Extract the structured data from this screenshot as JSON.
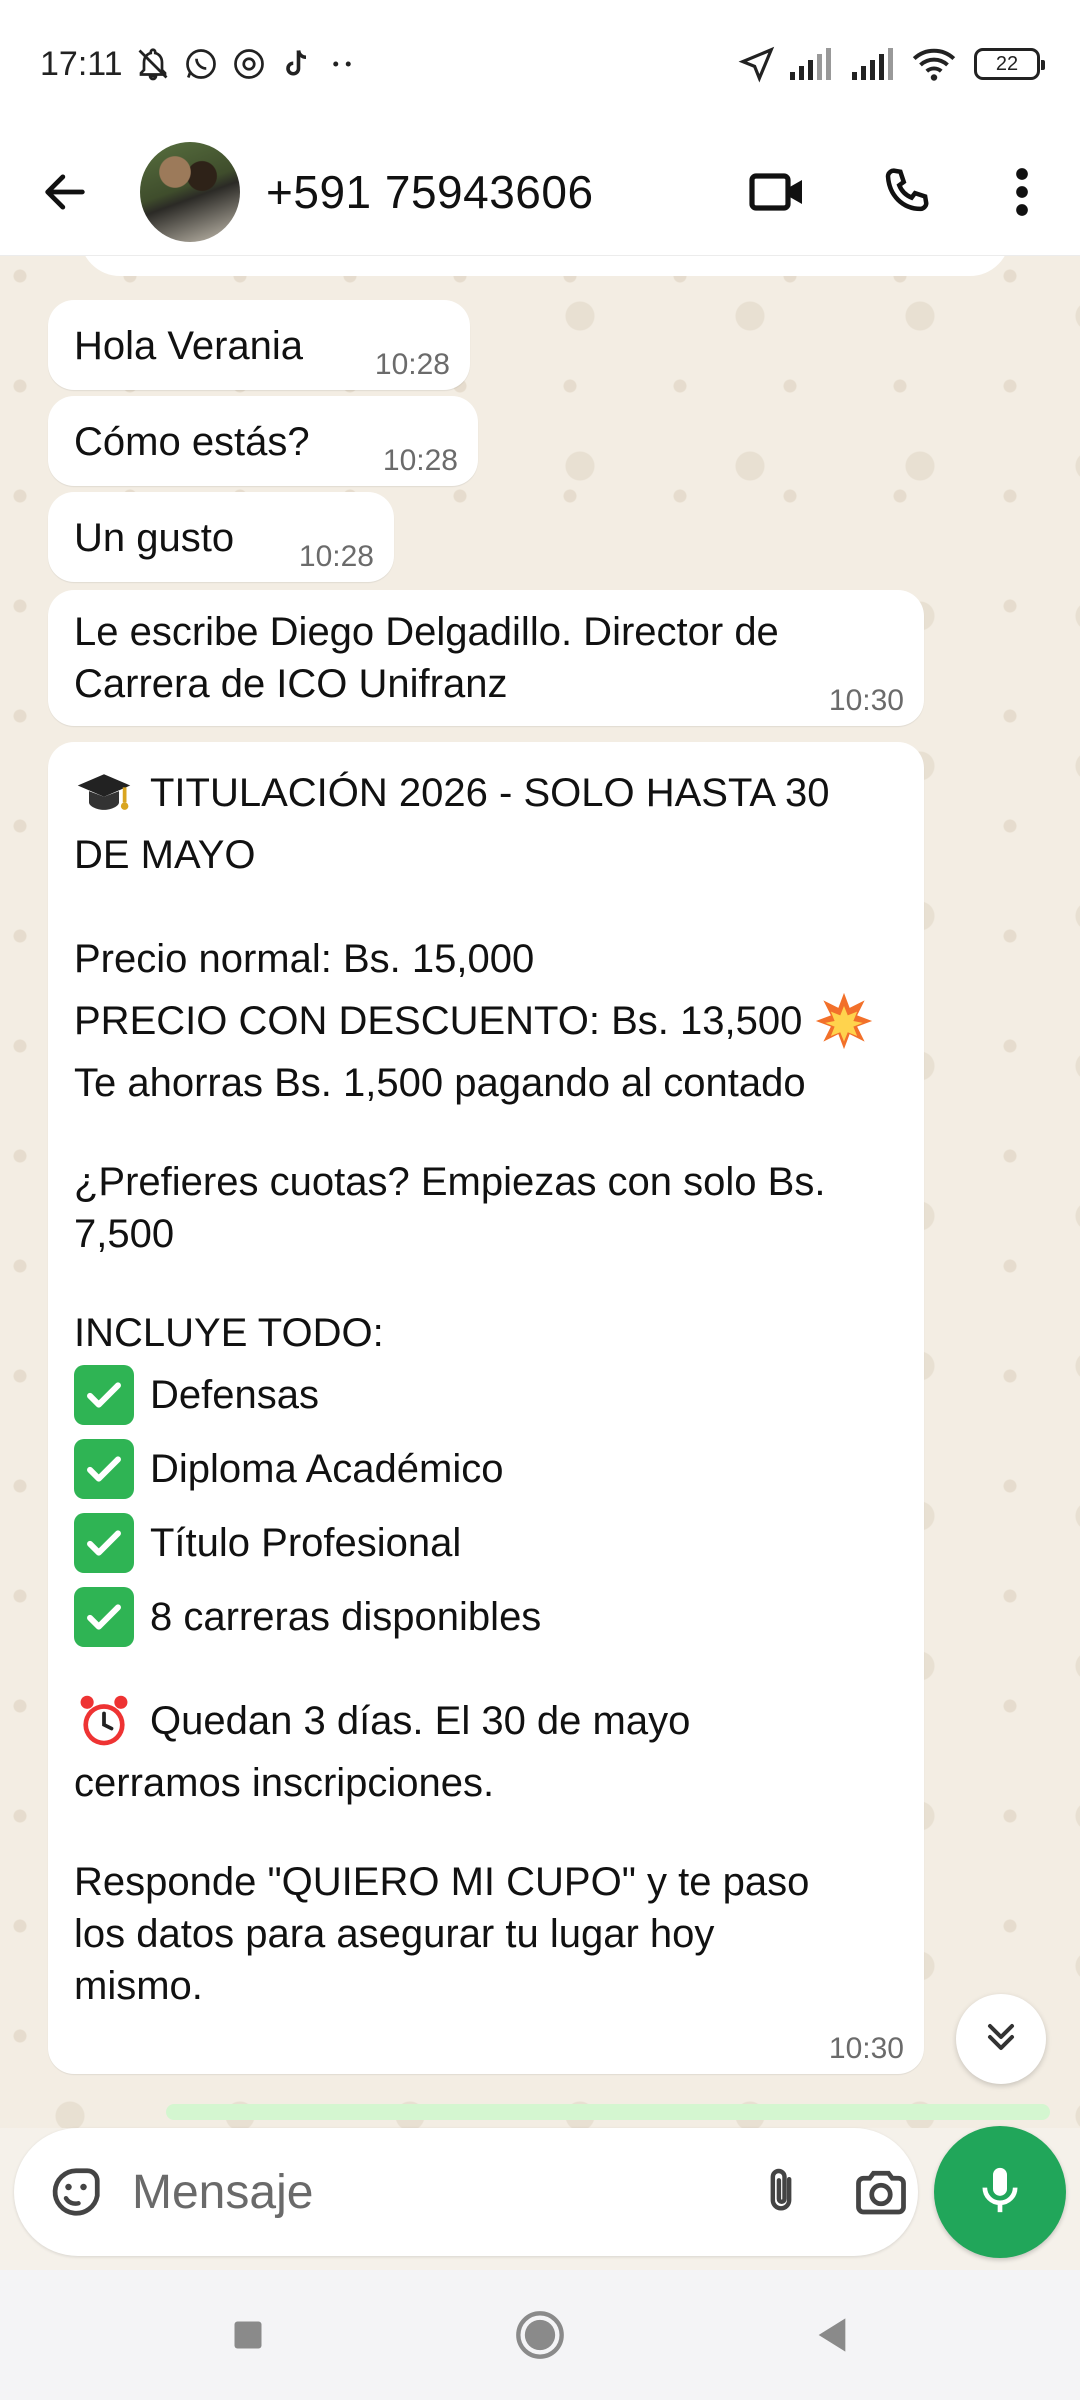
{
  "status_bar": {
    "time": "17:11",
    "battery": "22",
    "left_icons": [
      "bell-off-icon",
      "whatsapp-icon",
      "threads-icon",
      "tiktok-icon",
      "more-notifications-icon"
    ],
    "right_icons": [
      "location-arrow-icon",
      "signal-1-icon",
      "signal-2-icon",
      "wifi-icon",
      "battery-icon"
    ]
  },
  "header": {
    "contact": "+591 75943606",
    "icons": [
      "back-arrow-icon",
      "video-call-icon",
      "phone-call-icon",
      "more-vert-icon"
    ]
  },
  "messages": [
    {
      "text": "Hola Verania",
      "time": "10:28"
    },
    {
      "text": "Cómo estás?",
      "time": "10:28"
    },
    {
      "text": "Un gusto",
      "time": "10:28"
    },
    {
      "text": "Le escribe Diego Delgadillo. Director de\nCarrera de ICO Unifranz",
      "time": "10:30"
    }
  ],
  "promo": {
    "title": "TITULACIÓN 2026 - SOLO HASTA 30 DE MAYO",
    "title_line1": "TITULACIÓN 2026 - SOLO HASTA 30",
    "title_line2": "DE MAYO",
    "price_normal": "Precio normal: Bs. 15,000",
    "price_discount": "PRECIO CON DESCUENTO: Bs. 13,500",
    "savings": "Te ahorras Bs. 1,500 pagando al contado",
    "installments": "¿Prefieres cuotas? Empiezas con solo Bs.\n7,500",
    "includes_heading": "INCLUYE TODO:",
    "includes": [
      "Defensas",
      "Diploma Académico",
      "Título Profesional",
      "8 carreras disponibles"
    ],
    "deadline_line1": "Quedan 3 días. El 30 de mayo",
    "deadline_line2": "cerramos inscripciones.",
    "cta": "Responde \"QUIERO MI CUPO\" y te paso\nlos datos para asegurar tu lugar hoy\nmismo.",
    "time": "10:30",
    "emojis": [
      "graduation-cap-icon",
      "collision-icon",
      "check-mark-button-icon",
      "alarm-clock-icon"
    ]
  },
  "composer": {
    "placeholder": "Mensaje",
    "icons": [
      "sticker-emoji-icon",
      "paperclip-icon",
      "camera-icon",
      "microphone-icon"
    ]
  },
  "nav": {
    "icons": [
      "recents-square-icon",
      "home-circle-icon",
      "back-triangle-icon"
    ]
  },
  "colors": {
    "chat_background": "#f3ede3",
    "bubble": "#ffffff",
    "accent_green": "#21a65a",
    "check_green": "#2fb454"
  }
}
